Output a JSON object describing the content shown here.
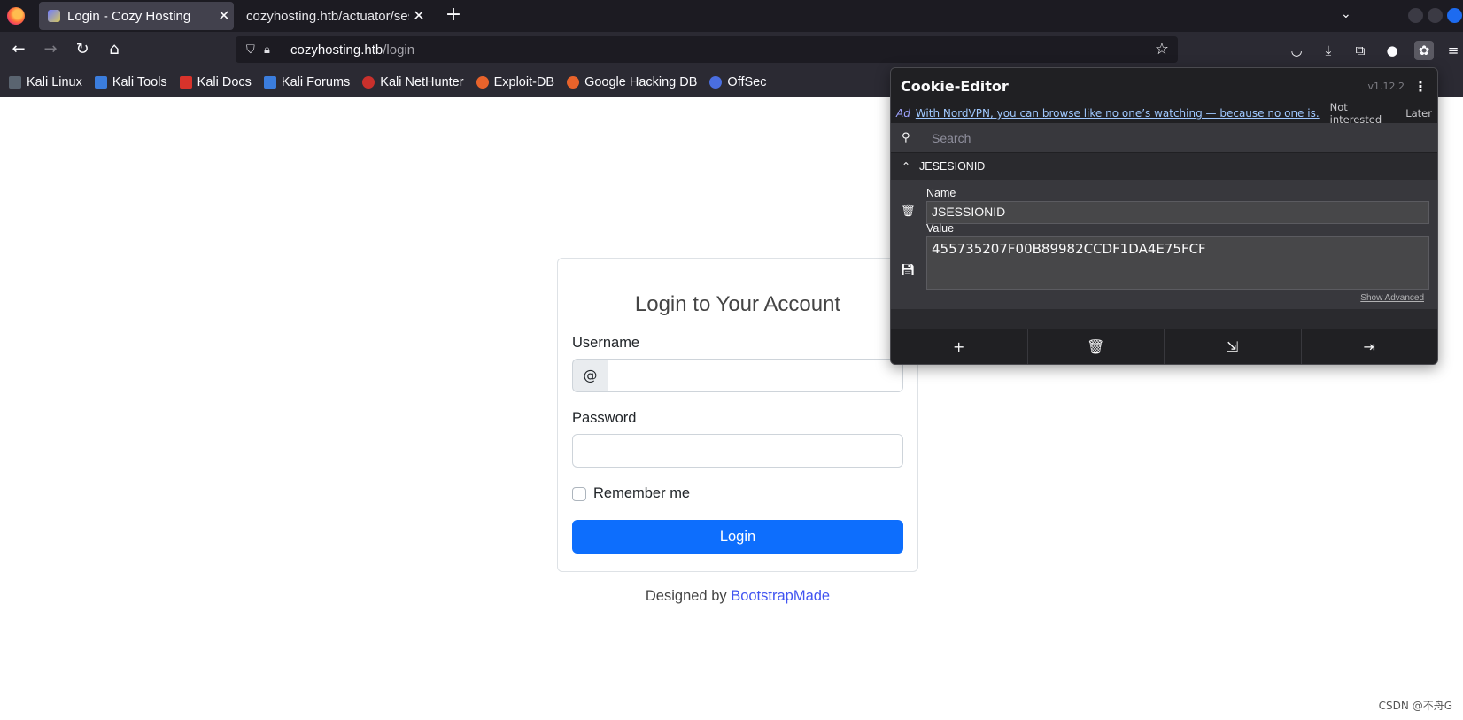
{
  "browser": {
    "tabs": [
      {
        "label": "Login - Cozy Hosting",
        "active": true
      },
      {
        "label": "cozyhosting.htb/actuator/ses",
        "active": false
      }
    ],
    "url_host": "cozyhosting.htb",
    "url_path": "/login",
    "bookmarks": [
      {
        "label": "Kali Linux",
        "icon": "kali-dragon-icon"
      },
      {
        "label": "Kali Tools",
        "icon": "kali-tools-icon"
      },
      {
        "label": "Kali Docs",
        "icon": "kali-docs-icon"
      },
      {
        "label": "Kali Forums",
        "icon": "kali-forums-icon"
      },
      {
        "label": "Kali NetHunter",
        "icon": "nethunter-icon"
      },
      {
        "label": "Exploit-DB",
        "icon": "exploit-db-icon"
      },
      {
        "label": "Google Hacking DB",
        "icon": "ghdb-icon"
      },
      {
        "label": "OffSec",
        "icon": "offsec-icon"
      }
    ]
  },
  "login": {
    "heading": "Login to Your Account",
    "username_label": "Username",
    "username_addon": "@",
    "username_value": "",
    "password_label": "Password",
    "password_value": "",
    "remember_label": "Remember me",
    "submit_label": "Login",
    "credits_prefix": "Designed by ",
    "credits_link": "BootstrapMade"
  },
  "cookie_editor": {
    "title": "Cookie-Editor",
    "version": "v1.12.2",
    "ad_tag": "Ad",
    "ad_text": "With NordVPN, you can browse like no one’s watching — because no one is.",
    "ad_not_interested": "Not interested",
    "ad_later": "Later",
    "search_placeholder": "Search",
    "cookie_row_name": "JESESIONID",
    "name_label": "Name",
    "name_value": "JSESSIONID",
    "value_label": "Value",
    "value_value": "455735207F00B89982CCDF1DA4E75FCF",
    "show_advanced": "Show Advanced"
  },
  "watermark": "CSDN @不舟G",
  "colors": {
    "primary_button": "#0d6efd",
    "link": "#4154f1",
    "popup_bg": "#2a2a2e"
  }
}
